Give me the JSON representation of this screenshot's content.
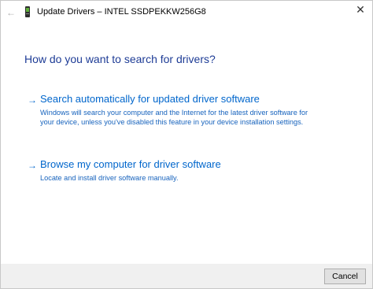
{
  "window": {
    "title": "Update Drivers – INTEL SSDPEKKW256G8",
    "back_icon": "back-arrow-icon",
    "device_icon": "device-icon",
    "close_label": "✕"
  },
  "content": {
    "heading": "How do you want to search for drivers?",
    "options": [
      {
        "arrow": "→",
        "title": "Search automatically for updated driver software",
        "description": "Windows will search your computer and the Internet for the latest driver software for your device, unless you've disabled this feature in your device installation settings."
      },
      {
        "arrow": "→",
        "title": "Browse my computer for driver software",
        "description": "Locate and install driver software manually."
      }
    ]
  },
  "footer": {
    "cancel_label": "Cancel"
  },
  "colors": {
    "link": "#0066cc",
    "heading": "#1e3c96",
    "footer_bg": "#f0f0f0"
  }
}
